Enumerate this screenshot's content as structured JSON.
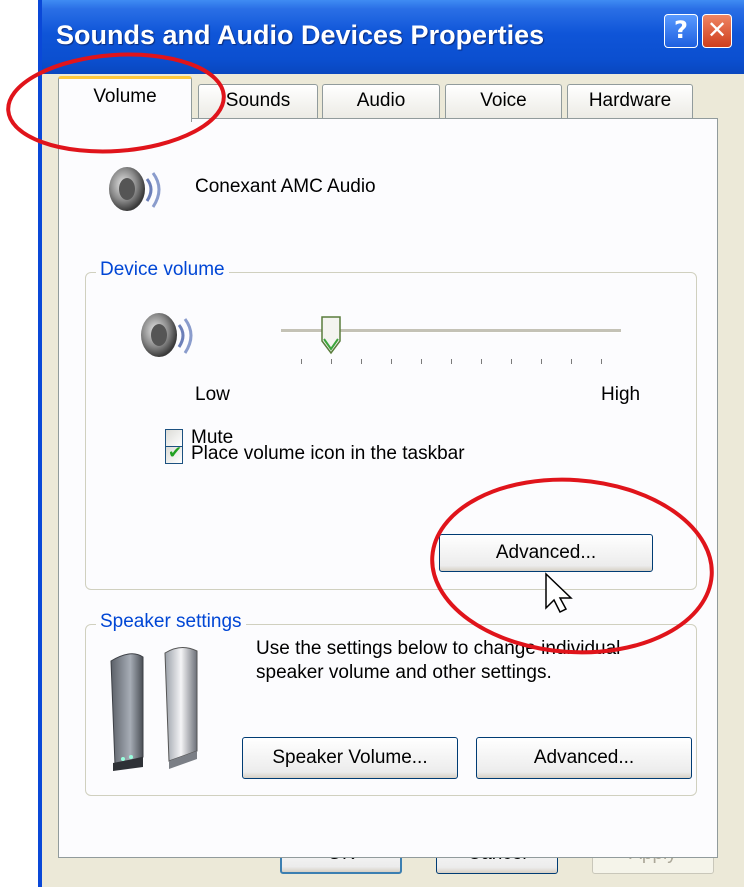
{
  "window": {
    "title": "Sounds and Audio Devices Properties",
    "help_label": "?",
    "close_label": "✕"
  },
  "tabs": [
    {
      "label": "Volume",
      "active": true
    },
    {
      "label": "Sounds"
    },
    {
      "label": "Audio"
    },
    {
      "label": "Voice"
    },
    {
      "label": "Hardware"
    }
  ],
  "device": {
    "name": "Conexant AMC Audio",
    "icon": "speaker-icon"
  },
  "device_volume": {
    "group_label": "Device volume",
    "low_label": "Low",
    "high_label": "High",
    "level": 0.1,
    "mute_label": "Mute",
    "mute_checked": false,
    "taskbar_label": "Place volume icon in the taskbar",
    "taskbar_checked": true,
    "advanced_label": "Advanced..."
  },
  "speaker_settings": {
    "group_label": "Speaker settings",
    "description_line1": "Use the settings below to change individual",
    "description_line2": "speaker volume and other settings.",
    "speaker_volume_label": "Speaker Volume...",
    "advanced_label": "Advanced..."
  },
  "footer": {
    "ok_label": "OK",
    "cancel_label": "Cancel",
    "apply_label": "Apply"
  },
  "colors": {
    "titlebar": "#0b4fd0",
    "group_label": "#0046d5",
    "annotation": "#e0141b"
  }
}
